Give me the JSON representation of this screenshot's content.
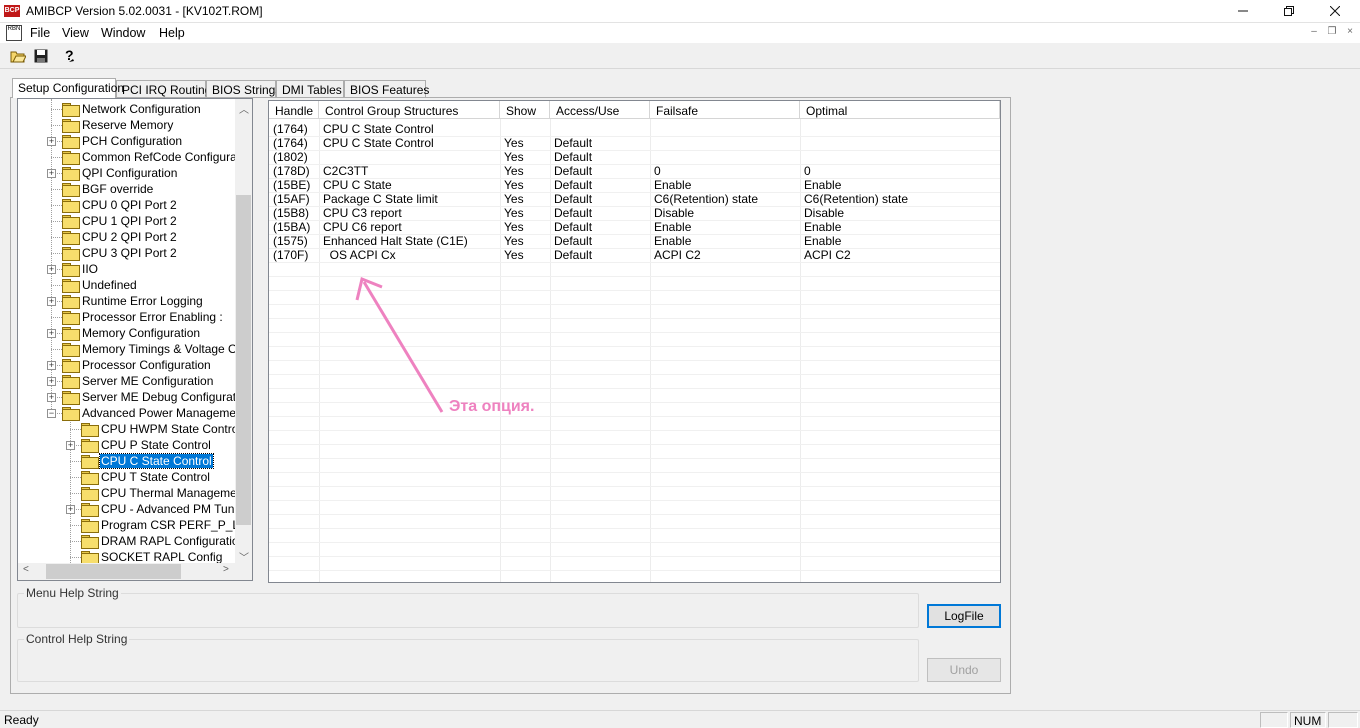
{
  "window": {
    "title": "AMIBCP Version 5.02.0031 - [KV102T.ROM]",
    "app_icon_text": "BCP",
    "min_icon": "minimize-icon",
    "max_icon": "maximize-icon",
    "close_icon": "close-icon"
  },
  "menubar": {
    "doc_icon_text": "RBN",
    "items": [
      "File",
      "View",
      "Window",
      "Help"
    ],
    "mdi_min": "–",
    "mdi_restore": "❐",
    "mdi_close": "×"
  },
  "toolbar": {
    "buttons": [
      "open-folder-icon",
      "save-icon",
      "help-icon"
    ]
  },
  "tabs": [
    "Setup Configuration",
    "PCI IRQ Routing",
    "BIOS Strings",
    "DMI Tables",
    "BIOS Features"
  ],
  "tree": {
    "items": [
      {
        "label": "Network Configuration",
        "expandable": false,
        "selected": false
      },
      {
        "label": "Reserve Memory",
        "expandable": false,
        "selected": false
      },
      {
        "label": "PCH Configuration",
        "expandable": true,
        "selected": false
      },
      {
        "label": "Common RefCode Configuration",
        "expandable": false,
        "selected": false
      },
      {
        "label": "QPI Configuration",
        "expandable": true,
        "selected": false
      },
      {
        "label": "BGF override",
        "expandable": false,
        "selected": false
      },
      {
        "label": "CPU 0 QPI Port 2",
        "expandable": false,
        "selected": false
      },
      {
        "label": "CPU 1 QPI Port 2",
        "expandable": false,
        "selected": false
      },
      {
        "label": "CPU 2 QPI Port 2",
        "expandable": false,
        "selected": false
      },
      {
        "label": "CPU 3 QPI Port 2",
        "expandable": false,
        "selected": false
      },
      {
        "label": "IIO",
        "expandable": true,
        "selected": false
      },
      {
        "label": "Undefined",
        "expandable": false,
        "selected": false
      },
      {
        "label": "Runtime Error Logging",
        "expandable": true,
        "selected": false
      },
      {
        "label": "Processor Error Enabling :",
        "expandable": false,
        "selected": false
      },
      {
        "label": "Memory Configuration",
        "expandable": true,
        "selected": false
      },
      {
        "label": "Memory Timings & Voltage Overr",
        "expandable": false,
        "selected": false
      },
      {
        "label": "Processor Configuration",
        "expandable": true,
        "selected": false
      },
      {
        "label": "Server ME Configuration",
        "expandable": true,
        "selected": false
      },
      {
        "label": "Server ME Debug Configuration",
        "expandable": true,
        "selected": false
      },
      {
        "label": "Advanced Power Management C",
        "expandable": true,
        "expanded": true,
        "selected": false
      },
      {
        "label": "CPU HWPM State Control",
        "expandable": false,
        "selected": false,
        "child": true
      },
      {
        "label": "CPU P State Control",
        "expandable": true,
        "selected": false,
        "child": true
      },
      {
        "label": "CPU C State Control",
        "expandable": false,
        "selected": true,
        "child": true,
        "open": true
      },
      {
        "label": "CPU T State Control",
        "expandable": false,
        "selected": false,
        "child": true
      },
      {
        "label": "CPU Thermal Management",
        "expandable": false,
        "selected": false,
        "child": true
      },
      {
        "label": "CPU - Advanced PM Tuning",
        "expandable": true,
        "selected": false,
        "child": true
      },
      {
        "label": "Program CSR PERF_P_LIMI",
        "expandable": false,
        "selected": false,
        "child": true
      },
      {
        "label": "DRAM RAPL Configuration",
        "expandable": false,
        "selected": false,
        "child": true
      },
      {
        "label": "SOCKET RAPL Config",
        "expandable": false,
        "selected": false,
        "child": true
      }
    ]
  },
  "grid": {
    "columns": [
      "Handle",
      "Control Group Structures",
      "Show",
      "Access/Use",
      "Failsafe",
      "Optimal"
    ],
    "rows": [
      [
        "(1764)",
        "CPU C State Control",
        "",
        "",
        "",
        ""
      ],
      [
        "(1764)",
        "CPU C State Control",
        "Yes",
        "Default",
        "",
        ""
      ],
      [
        "(1802)",
        "",
        "Yes",
        "Default",
        "",
        ""
      ],
      [
        "(178D)",
        "C2C3TT",
        "Yes",
        "Default",
        "0",
        "0"
      ],
      [
        "(15BE)",
        "CPU C State",
        "Yes",
        "Default",
        "Enable",
        "Enable"
      ],
      [
        "(15AF)",
        "Package C State limit",
        "Yes",
        "Default",
        "C6(Retention) state",
        "C6(Retention) state"
      ],
      [
        "(15B8)",
        "CPU C3 report",
        "Yes",
        "Default",
        "Disable",
        "Disable"
      ],
      [
        "(15BA)",
        "CPU C6 report",
        "Yes",
        "Default",
        "Enable",
        "Enable"
      ],
      [
        "(1575)",
        "Enhanced Halt State (C1E)",
        "Yes",
        "Default",
        "Enable",
        "Enable"
      ],
      [
        "(170F)",
        "  OS ACPI Cx",
        "Yes",
        "Default",
        "ACPI C2",
        "ACPI C2"
      ]
    ]
  },
  "help": {
    "menu_label": "Menu Help String",
    "control_label": "Control Help String"
  },
  "buttons": {
    "logfile": "LogFile",
    "undo": "Undo"
  },
  "status": {
    "text": "Ready",
    "num": "NUM"
  },
  "annotation": {
    "text": "Эта опция.",
    "color": "#ee82c0"
  }
}
